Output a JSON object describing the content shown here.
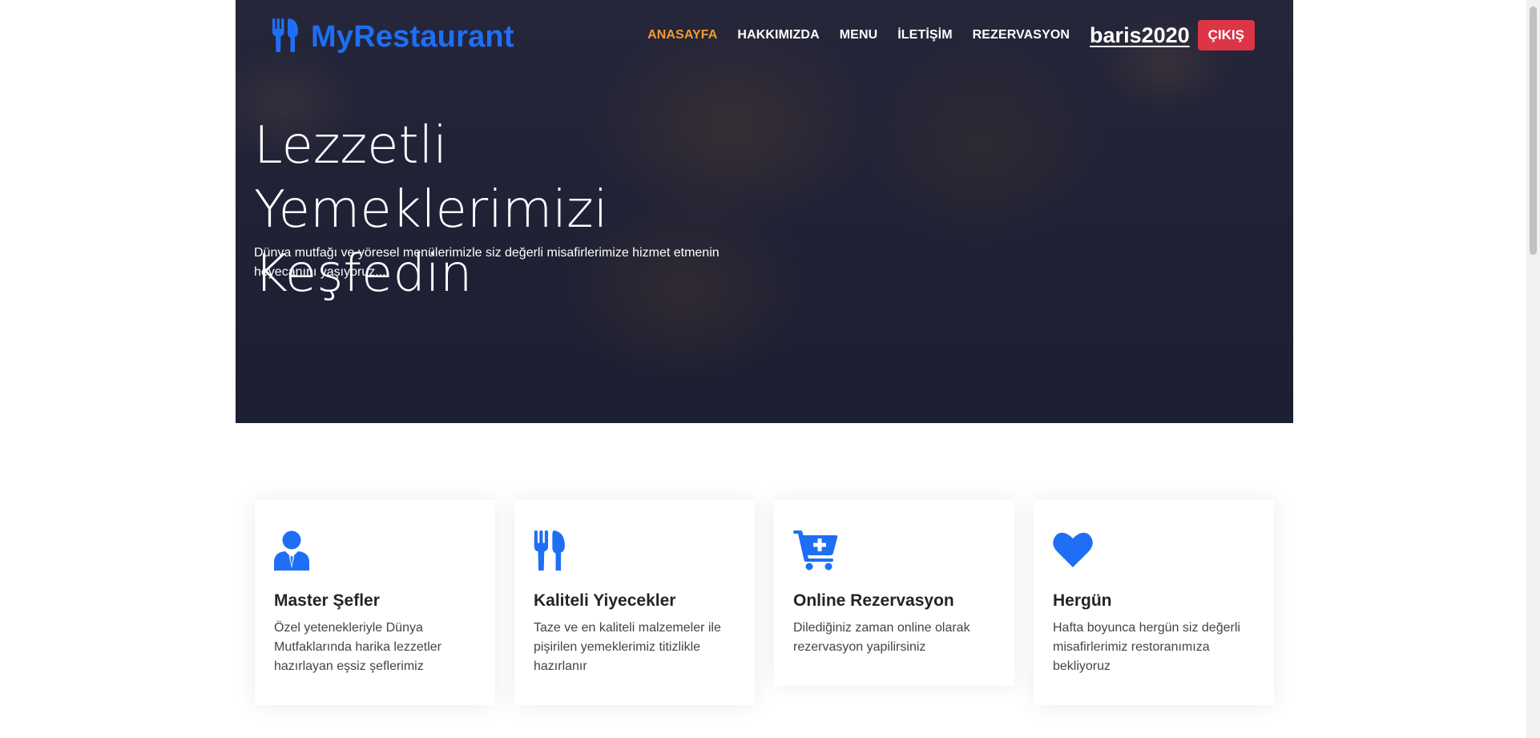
{
  "brand": {
    "name": "MyRestaurant",
    "icon": "utensils-icon",
    "color": "#1e6ff5"
  },
  "nav": {
    "items": [
      {
        "label": "ANASAYFA",
        "active": true
      },
      {
        "label": "HAKKIMIZDA",
        "active": false
      },
      {
        "label": "MENU",
        "active": false
      },
      {
        "label": "İLETİŞİM",
        "active": false
      },
      {
        "label": "REZERVASYON",
        "active": false
      }
    ],
    "username": "baris2020",
    "logout_label": "ÇIKIŞ",
    "active_color": "#f39a2b",
    "logout_color": "#dc3545"
  },
  "hero": {
    "title": "Lezzetli Yemeklerimizi Keşfedin",
    "subtitle": "Dünya mutfağı ve yöresel menülerimizle siz değerli misafirlerimize hizmet etmenin heyecanını yaşıyoruz..."
  },
  "features": [
    {
      "icon": "chef-user-icon",
      "title": "Master Şefler",
      "text": "Özel yetenekleriyle Dünya Mutfaklarında harika lezzetler hazırlayan eşsiz şeflerimiz"
    },
    {
      "icon": "utensils-icon",
      "title": "Kaliteli Yiyecekler",
      "text": "Taze ve en kaliteli malzemeler ile pişirilen yemeklerimiz titizlikle hazırlanır"
    },
    {
      "icon": "cart-plus-icon",
      "title": "Online Rezervasyon",
      "text": "Dilediğiniz zaman online olarak rezervasyon yapilirsiniz"
    },
    {
      "icon": "heart-icon",
      "title": "Hergün",
      "text": "Hafta boyunca hergün siz değerli misafirlerimiz restoranımıza bekliyoruz"
    }
  ]
}
